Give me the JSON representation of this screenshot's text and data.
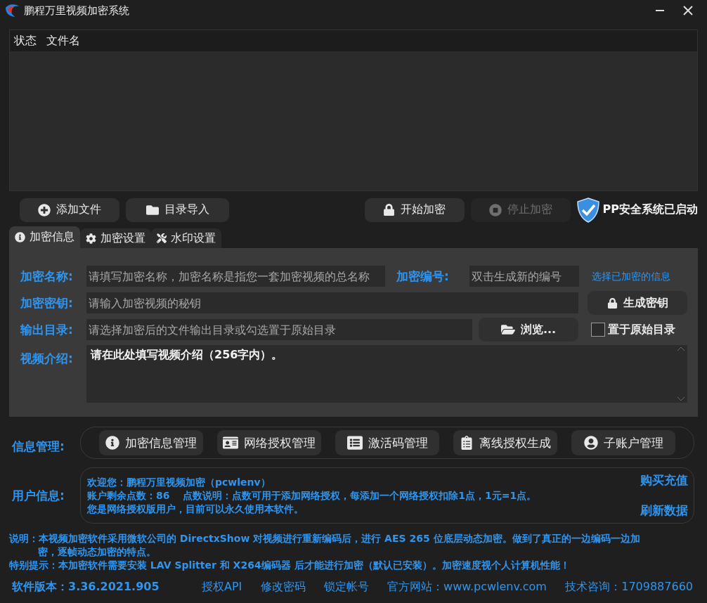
{
  "window": {
    "title": "鹏程万里视频加密系统"
  },
  "file_list": {
    "columns": [
      "状态",
      "文件名"
    ]
  },
  "toolbar": {
    "left_buttons": [
      {
        "kind": "add",
        "label": "添加文件",
        "disabled": false
      },
      {
        "kind": "folder",
        "label": "目录导入",
        "disabled": false
      }
    ],
    "right_buttons": [
      {
        "kind": "lock",
        "label": "开始加密",
        "disabled": false
      },
      {
        "kind": "stop",
        "label": "停止加密",
        "disabled": true
      }
    ],
    "status": "PP安全系统已启动"
  },
  "tabs": [
    {
      "kind": "info",
      "label": "加密信息",
      "selected": true
    },
    {
      "kind": "gear",
      "label": "加密设置",
      "selected": false
    },
    {
      "kind": "tools",
      "label": "水印设置",
      "selected": false
    }
  ],
  "form": {
    "name_label": "加密名称:",
    "name_placeholder": "请填写加密名称，加密名称是指您一套加密视频的总名称",
    "number_label": "加密编号:",
    "number_placeholder": "双击生成新的编号",
    "select_link": "选择已加密的信息",
    "key_label": "加密密钥:",
    "key_placeholder": "请输入加密视频的秘钥",
    "generate_button": "生成密钥",
    "output_label": "输出目录:",
    "output_placeholder": "请选择加密后的文件输出目录或勾选置于原始目录",
    "browse_button": "浏览...",
    "keep_original": {
      "label": "置于原始目录",
      "checked": false
    },
    "intro_label": "视频介绍:",
    "intro_value": "请在此处填写视频介绍（256字内）。"
  },
  "info_management": {
    "label": "信息管理:",
    "buttons": [
      {
        "kind": "info",
        "label": "加密信息管理"
      },
      {
        "kind": "card",
        "label": "网络授权管理"
      },
      {
        "kind": "list",
        "label": "激活码管理"
      },
      {
        "kind": "doc",
        "label": "离线授权生成"
      },
      {
        "kind": "user",
        "label": "子账户管理"
      }
    ]
  },
  "user_info": {
    "label": "用户信息:",
    "lines": [
      "欢迎您：鹏程万里视频加密（pcwlenv）",
      "账户剩余点数：86　 点数说明：点数可用于添加网络授权，每添加一个网络授权扣除1点，1元=1点。",
      "您是网络授权版用户，目前可以永久使用本软件。"
    ],
    "links": [
      "购买充值",
      "刷新数据"
    ]
  },
  "notes": [
    "说明：本视频加密软件采用微软公司的 DirectxShow 对视频进行重新编码后，进行 AES 265 位底层动态加密。做到了真正的一边编码一边加密，逐帧动态加密的特点。",
    "特别提示：本加密软件需要安装 LAV Splitter 和 X264编码器 后才能进行加密（默认已安装）。加密速度视个人计算机性能！"
  ],
  "footer": {
    "version": "软件版本：3.36.2021.905",
    "links": [
      "授权API",
      "修改密码",
      "锁定帐号",
      "官方网站：www.pcwlenv.com",
      "技术咨询：1709887660"
    ]
  }
}
